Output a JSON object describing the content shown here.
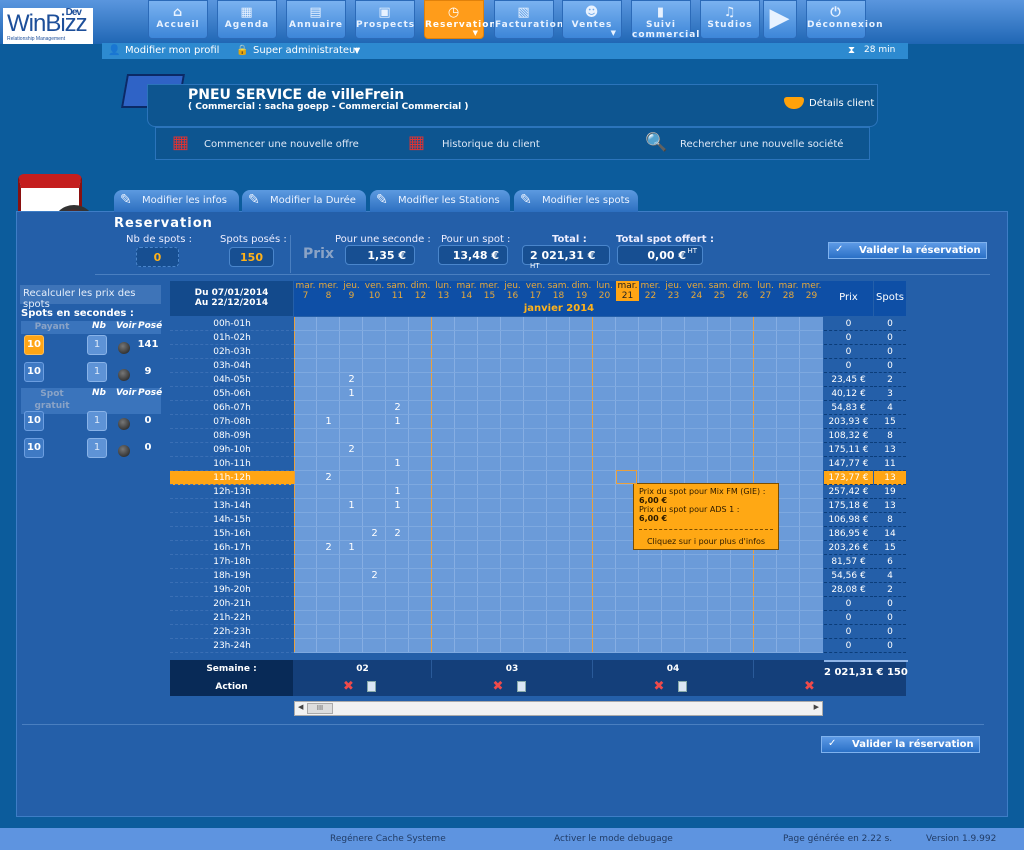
{
  "logo": {
    "name": "WinBizz",
    "tag": "Dev",
    "sub": "Relationship Management"
  },
  "nav": [
    {
      "label": "Accueil",
      "icon": "home-icon",
      "glyph": "⌂"
    },
    {
      "label": "Agenda",
      "icon": "calendar-icon",
      "glyph": "▦"
    },
    {
      "label": "Annuaire",
      "icon": "address-book-icon",
      "glyph": "▤"
    },
    {
      "label": "Prospects",
      "icon": "briefcase-icon",
      "glyph": "▣"
    },
    {
      "label": "Reservation",
      "icon": "clock-icon",
      "glyph": "◷",
      "active": true
    },
    {
      "label": "Facturation",
      "icon": "invoice-icon",
      "glyph": "▧"
    },
    {
      "label": "Ventes",
      "icon": "users-icon",
      "glyph": "☻"
    },
    {
      "label": "Suivi commercial",
      "icon": "bar-chart-icon",
      "glyph": "▮"
    },
    {
      "label": "Studios",
      "icon": "microphone-icon",
      "glyph": "♫"
    },
    {
      "label": "Déconnexion",
      "icon": "power-icon",
      "glyph": "⏻"
    }
  ],
  "subbar": {
    "profile": "Modifier mon profil",
    "role": "Super administrateur",
    "timer": "28 min"
  },
  "client": {
    "name": "PNEU SERVICE de villeFrein",
    "sub": "( Commercial : sacha goepp - Commercial Commercial )",
    "details": "Détails client",
    "actions": [
      "Commencer une nouvelle offre",
      "Historique du client",
      "Rechercher une nouvelle société"
    ]
  },
  "tabs": [
    "Modifier les infos",
    "Modifier la Durée",
    "Modifier les Stations",
    "Modifier les spots"
  ],
  "reservation": {
    "title": "Reservation",
    "nb_spots_label": "Nb de spots :",
    "nb_spots": "0",
    "poses_label": "Spots posés :",
    "poses": "150",
    "prix_label": "Prix",
    "sec_label": "Pour une seconde :",
    "sec": "1,35 €",
    "spot_label": "Pour un spot :",
    "spot": "13,48 €",
    "total_label": "Total :",
    "total": "2 021,31 €",
    "ht": "HT",
    "offert_label": "Total spot offert :",
    "offert": "0,00 €",
    "validate": "Valider la réservation"
  },
  "left": {
    "recalc": "Recalculer les prix des spots",
    "title": "Spots en secondes :",
    "payant": "Payant",
    "gratuit": "Spot gratuit",
    "nb": "Nb",
    "voir": "Voir",
    "pose": "Posé",
    "payant_rows": [
      {
        "sec": "10",
        "nb": "1",
        "pose": "141",
        "active": true
      },
      {
        "sec": "10",
        "nb": "1",
        "pose": "9"
      }
    ],
    "gratuit_rows": [
      {
        "sec": "10",
        "nb": "1",
        "pose": "0"
      },
      {
        "sec": "10",
        "nb": "1",
        "pose": "0"
      }
    ]
  },
  "grid": {
    "from": "Du 07/01/2014",
    "to": "Au 22/12/2014",
    "month": "janvier 2014",
    "prix_header": "Prix",
    "spots_header": "Spots",
    "highlight_day": 21,
    "highlight_row": "11h-12h",
    "days": [
      [
        "mar.",
        7
      ],
      [
        "mer.",
        8
      ],
      [
        "jeu.",
        9
      ],
      [
        "ven.",
        10
      ],
      [
        "sam.",
        11
      ],
      [
        "dim.",
        12
      ],
      [
        "lun.",
        13
      ],
      [
        "mar.",
        14
      ],
      [
        "mer.",
        15
      ],
      [
        "jeu.",
        16
      ],
      [
        "ven.",
        17
      ],
      [
        "sam.",
        18
      ],
      [
        "dim.",
        19
      ],
      [
        "lun.",
        20
      ],
      [
        "mar.",
        21
      ],
      [
        "mer.",
        22
      ],
      [
        "jeu.",
        23
      ],
      [
        "ven.",
        24
      ],
      [
        "sam.",
        25
      ],
      [
        "dim.",
        26
      ],
      [
        "lun.",
        27
      ],
      [
        "mar.",
        28
      ],
      [
        "mer.",
        29
      ]
    ],
    "rows": [
      {
        "label": "00h-01h",
        "prix": "0",
        "spots": "0"
      },
      {
        "label": "01h-02h",
        "prix": "0",
        "spots": "0"
      },
      {
        "label": "02h-03h",
        "prix": "0",
        "spots": "0"
      },
      {
        "label": "03h-04h",
        "prix": "0",
        "spots": "0"
      },
      {
        "label": "04h-05h",
        "prix": "23,45 €",
        "spots": "2"
      },
      {
        "label": "05h-06h",
        "prix": "40,12 €",
        "spots": "3"
      },
      {
        "label": "06h-07h",
        "prix": "54,83 €",
        "spots": "4"
      },
      {
        "label": "07h-08h",
        "prix": "203,93 €",
        "spots": "15"
      },
      {
        "label": "08h-09h",
        "prix": "108,32 €",
        "spots": "8"
      },
      {
        "label": "09h-10h",
        "prix": "175,11 €",
        "spots": "13"
      },
      {
        "label": "10h-11h",
        "prix": "147,77 €",
        "spots": "11"
      },
      {
        "label": "11h-12h",
        "prix": "173,77 €",
        "spots": "13"
      },
      {
        "label": "12h-13h",
        "prix": "257,42 €",
        "spots": "19"
      },
      {
        "label": "13h-14h",
        "prix": "175,18 €",
        "spots": "13"
      },
      {
        "label": "14h-15h",
        "prix": "106,98 €",
        "spots": "8"
      },
      {
        "label": "15h-16h",
        "prix": "186,95 €",
        "spots": "14"
      },
      {
        "label": "16h-17h",
        "prix": "203,26 €",
        "spots": "15"
      },
      {
        "label": "17h-18h",
        "prix": "81,57 €",
        "spots": "6"
      },
      {
        "label": "18h-19h",
        "prix": "54,56 €",
        "spots": "4"
      },
      {
        "label": "19h-20h",
        "prix": "28,08 €",
        "spots": "2"
      },
      {
        "label": "20h-21h",
        "prix": "0",
        "spots": "0"
      },
      {
        "label": "21h-22h",
        "prix": "0",
        "spots": "0"
      },
      {
        "label": "22h-23h",
        "prix": "0",
        "spots": "0"
      },
      {
        "label": "23h-24h",
        "prix": "0",
        "spots": "0"
      }
    ],
    "cells": [
      {
        "row": "04h-05h",
        "day": 9,
        "value": "2"
      },
      {
        "row": "05h-06h",
        "day": 9,
        "value": "1"
      },
      {
        "row": "06h-07h",
        "day": 11,
        "value": "2"
      },
      {
        "row": "07h-08h",
        "day": 8,
        "value": "1"
      },
      {
        "row": "07h-08h",
        "day": 11,
        "value": "1"
      },
      {
        "row": "09h-10h",
        "day": 9,
        "value": "2"
      },
      {
        "row": "10h-11h",
        "day": 11,
        "value": "1"
      },
      {
        "row": "11h-12h",
        "day": 8,
        "value": "2"
      },
      {
        "row": "12h-13h",
        "day": 11,
        "value": "1"
      },
      {
        "row": "13h-14h",
        "day": 9,
        "value": "1"
      },
      {
        "row": "13h-14h",
        "day": 11,
        "value": "1"
      },
      {
        "row": "15h-16h",
        "day": 10,
        "value": "2"
      },
      {
        "row": "15h-16h",
        "day": 11,
        "value": "2"
      },
      {
        "row": "16h-17h",
        "day": 8,
        "value": "2"
      },
      {
        "row": "16h-17h",
        "day": 9,
        "value": "1"
      },
      {
        "row": "18h-19h",
        "day": 10,
        "value": "2"
      }
    ],
    "week_label": "Semaine :",
    "action_label": "Action",
    "weeks": [
      "02",
      "03",
      "04"
    ],
    "total": "2 021,31 € 150"
  },
  "tooltip": {
    "line1": "Prix du spot pour Mix FM (GIE) :",
    "val1": "6,00 €",
    "line2": "Prix du spot pour ADS 1 :",
    "val2": "6,00 €",
    "more": "Cliquez sur i pour plus d'infos"
  },
  "footer": {
    "cache": "Regénere Cache Systeme",
    "debug": "Activer le mode debugage",
    "generated": "Page générée en 2.22 s.",
    "version": "Version 1.9.992"
  }
}
